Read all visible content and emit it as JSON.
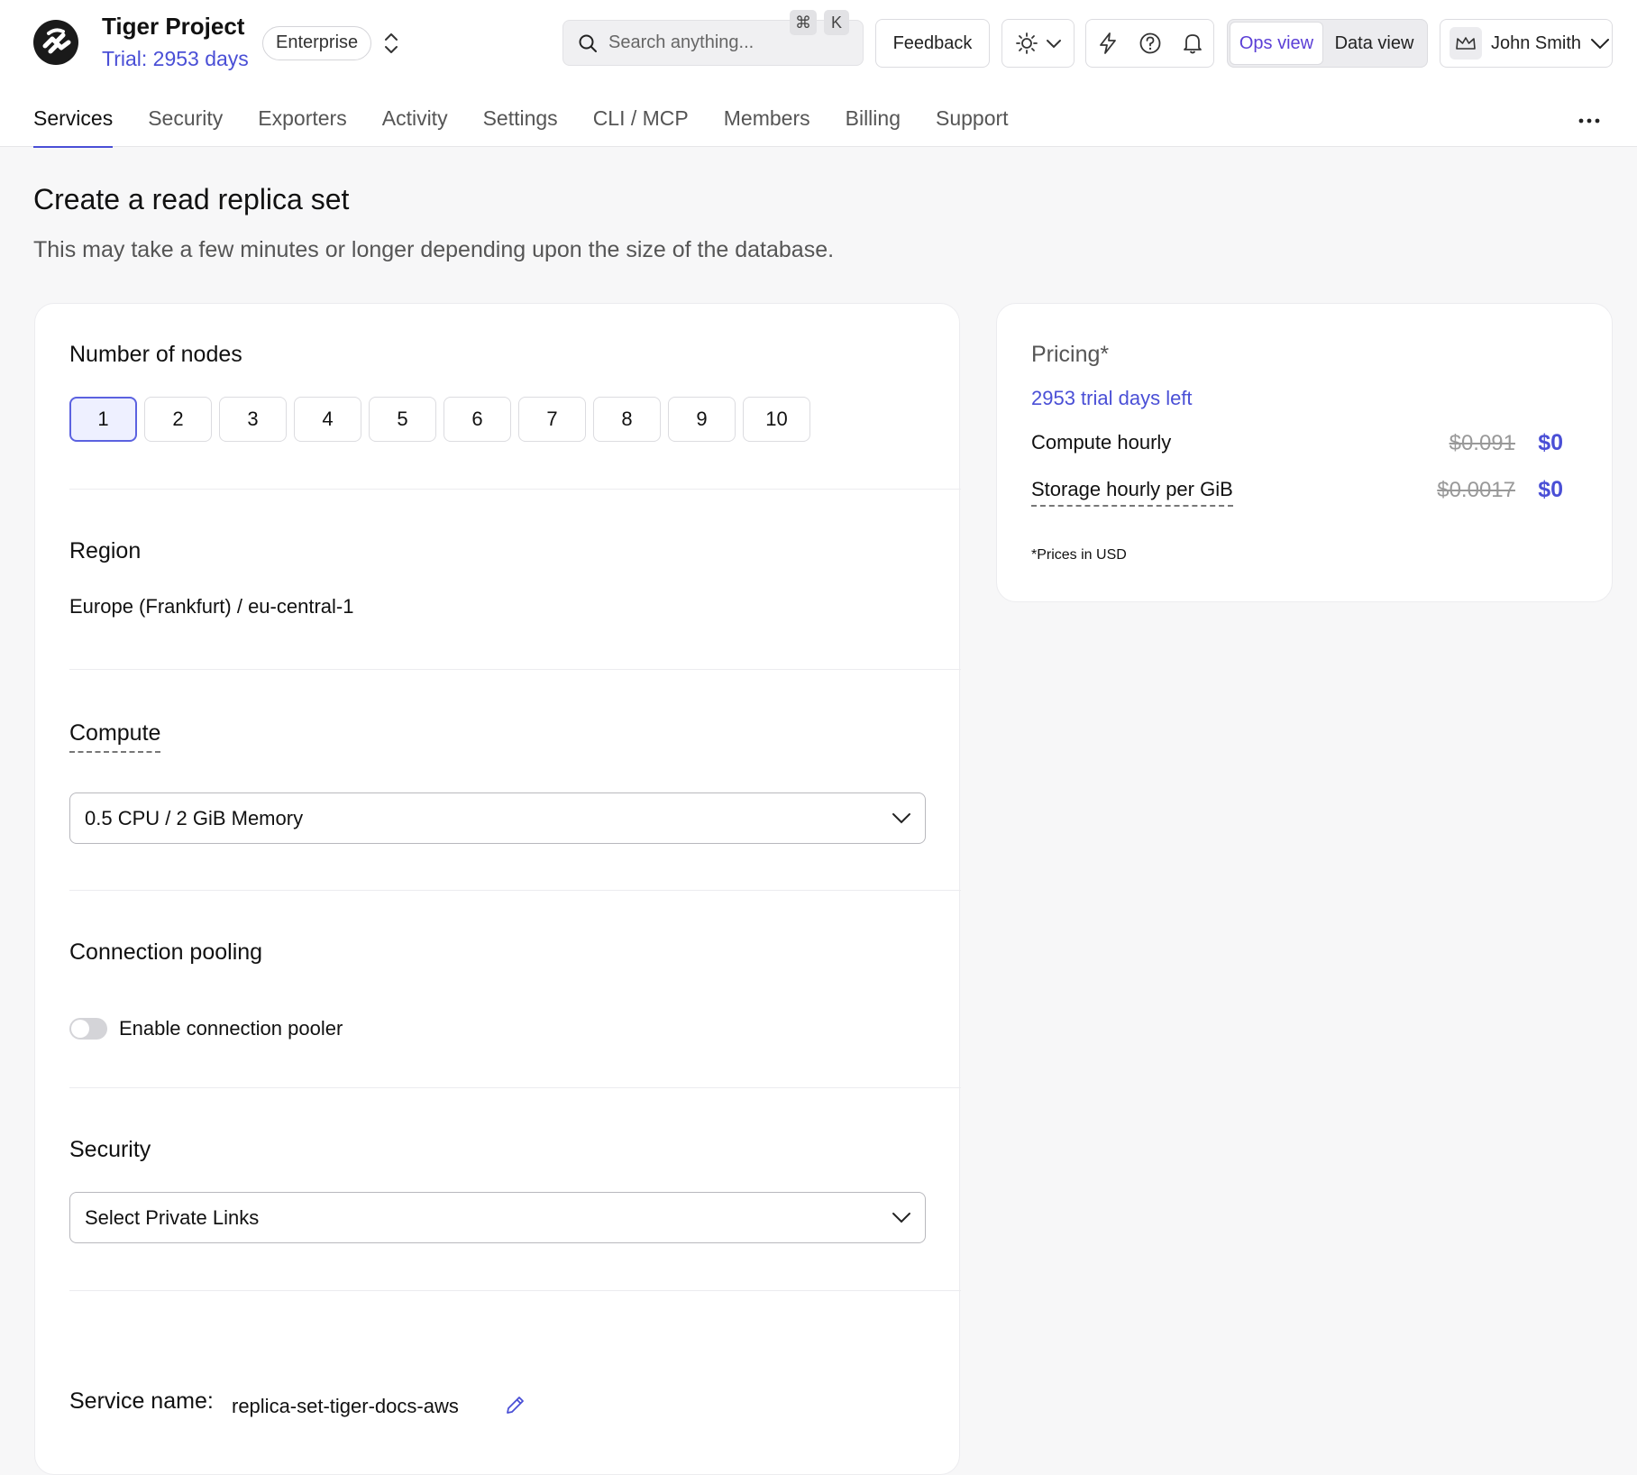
{
  "header": {
    "project_title": "Tiger Project",
    "trial_text": "Trial: 2953 days",
    "plan_badge": "Enterprise",
    "search_placeholder": "Search anything...",
    "search_shortcut_cmd": "⌘",
    "search_shortcut_key": "K",
    "feedback_label": "Feedback",
    "view_toggle": {
      "ops": "Ops view",
      "data": "Data view",
      "active": "ops"
    },
    "user_name": "John Smith"
  },
  "tabs": [
    {
      "label": "Services",
      "active": true
    },
    {
      "label": "Security"
    },
    {
      "label": "Exporters"
    },
    {
      "label": "Activity"
    },
    {
      "label": "Settings"
    },
    {
      "label": "CLI / MCP"
    },
    {
      "label": "Members"
    },
    {
      "label": "Billing"
    },
    {
      "label": "Support"
    }
  ],
  "page": {
    "title": "Create a read replica set",
    "subtitle": "This may take a few minutes or longer depending upon the size of the database."
  },
  "form": {
    "nodes_label": "Number of nodes",
    "nodes": [
      "1",
      "2",
      "3",
      "4",
      "5",
      "6",
      "7",
      "8",
      "9",
      "10"
    ],
    "nodes_selected": "1",
    "region_label": "Region",
    "region_value": "Europe (Frankfurt) / eu-central-1",
    "compute_label": "Compute",
    "compute_value": "0.5 CPU / 2 GiB Memory",
    "pooling_label": "Connection pooling",
    "pooling_toggle_label": "Enable connection pooler",
    "pooling_enabled": false,
    "security_label": "Security",
    "security_value": "Select Private Links",
    "service_name_label": "Service name:",
    "service_name_value": "replica-set-tiger-docs-aws"
  },
  "pricing": {
    "title": "Pricing*",
    "trial_left": "2953 trial days left",
    "compute_label": "Compute hourly",
    "compute_old": "$0.091",
    "compute_new": "$0",
    "storage_label": "Storage hourly per GiB",
    "storage_old": "$0.0017",
    "storage_new": "$0",
    "note": "*Prices in USD"
  },
  "colors": {
    "accent": "#4a4fd6",
    "ops_view_active": "#5b3fd6",
    "node_selected_bg": "#eef0ff",
    "node_selected_border": "#5b62e0"
  }
}
